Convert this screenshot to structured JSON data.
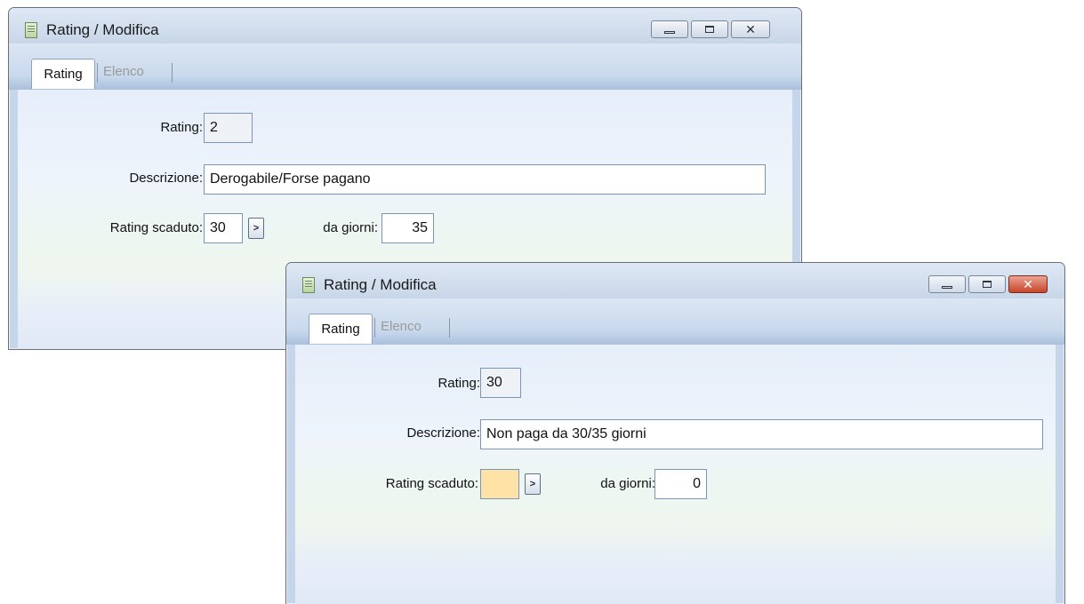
{
  "windows": [
    {
      "title": "Rating / Modifica",
      "tabs": {
        "active": "Rating",
        "inactive": "Elenco"
      },
      "form": {
        "rating_label": "Rating:",
        "rating_value": "2",
        "descrizione_label": "Descrizione:",
        "descrizione_value": "Derogabile/Forse pagano",
        "scaduto_label": "Rating scaduto:",
        "scaduto_value": "30",
        "giorni_label": "da giorni:",
        "giorni_value": "35"
      }
    },
    {
      "title": "Rating / Modifica",
      "tabs": {
        "active": "Rating",
        "inactive": "Elenco"
      },
      "form": {
        "rating_label": "Rating:",
        "rating_value": "30",
        "descrizione_label": "Descrizione:",
        "descrizione_value": "Non paga da 30/35 giorni",
        "scaduto_label": "Rating scaduto:",
        "scaduto_value": "",
        "giorni_label": "da giorni:",
        "giorni_value": "0"
      }
    }
  ],
  "icons": {
    "app": "document-list-icon",
    "minimize": "minimize-icon",
    "maximize": "maximize-icon",
    "close": "close-icon",
    "zoom": "chevron-right-icon"
  }
}
